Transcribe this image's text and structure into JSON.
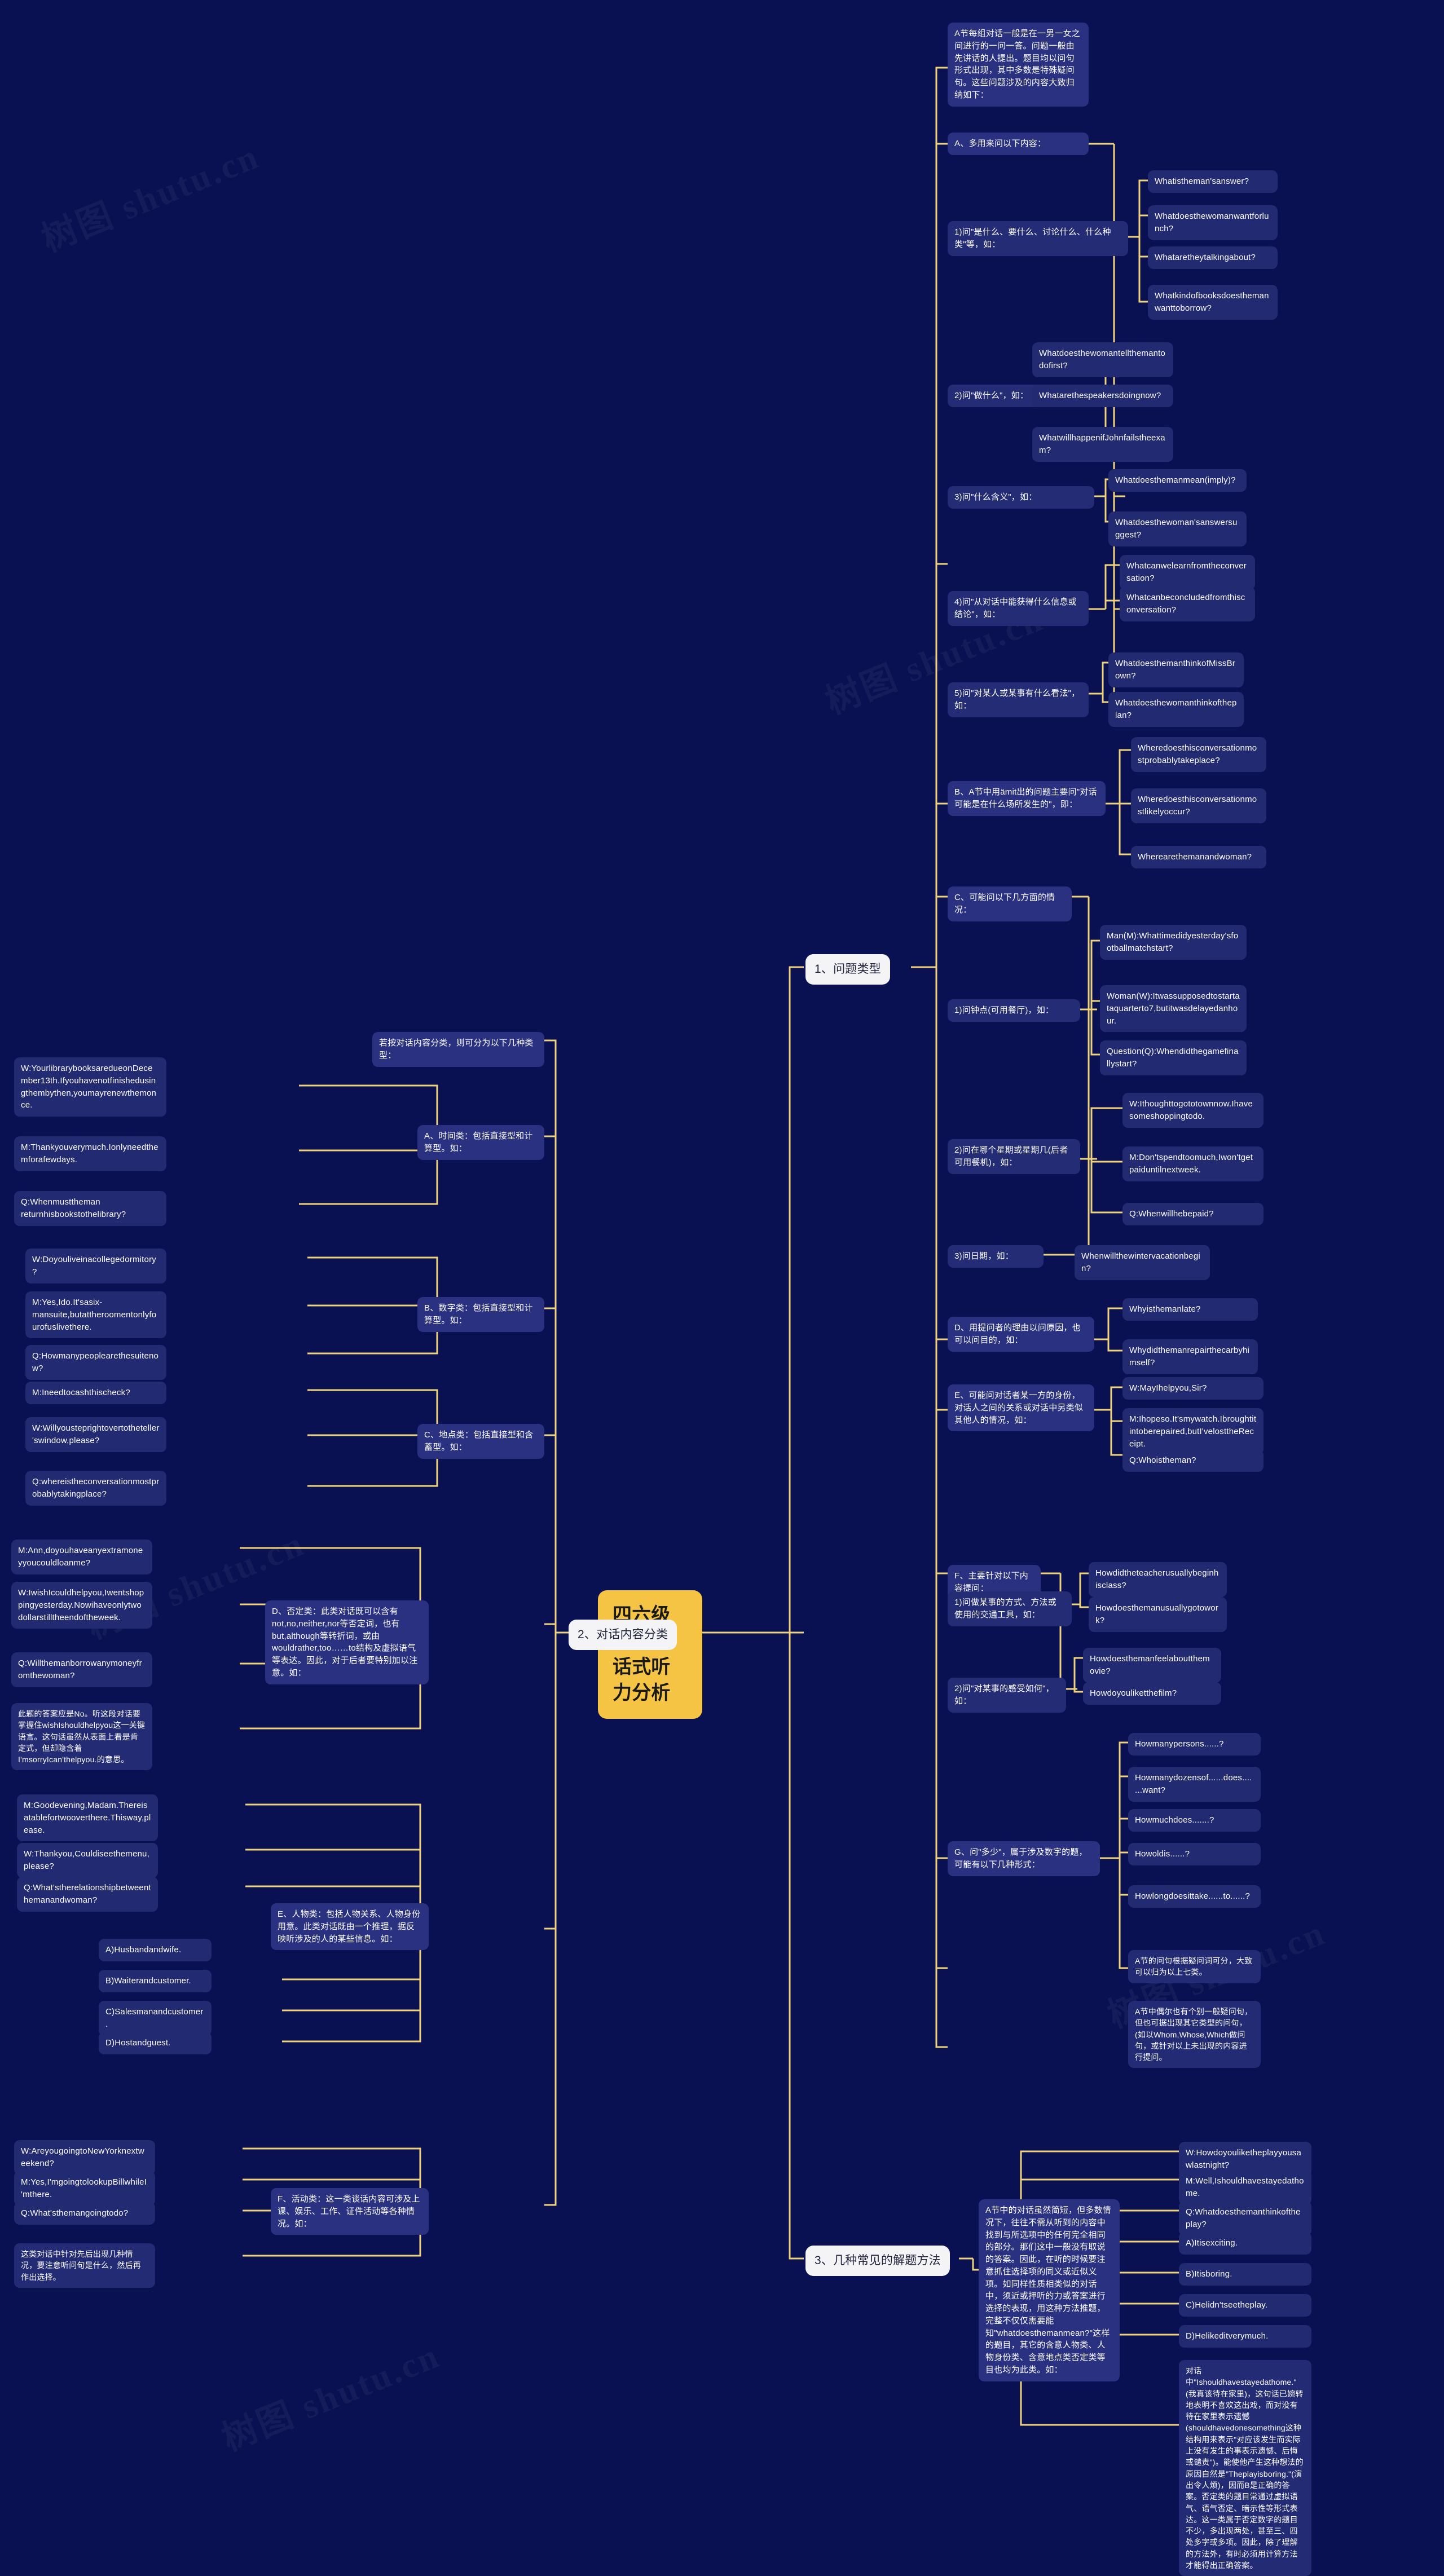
{
  "theme": {
    "background": "#0a1152",
    "root_fill": "#f5c444",
    "branch_pill_fill": "#f4f4f6",
    "node_fill": "#2a3180",
    "link_color": "#f0d27a",
    "text_light": "#ffffff",
    "text_dark": "#20243c"
  },
  "watermarks": [
    "树图 shutu.cn",
    "树图 shutu.cn",
    "树图 shutu.cn",
    "树图 shutu.cn",
    "树图 shutu.cn"
  ],
  "root": {
    "label": "四六级考试对话式听力分析"
  },
  "branches": [
    {
      "id": "b1",
      "label": "1、问题类型"
    },
    {
      "id": "b2",
      "label": "2、对话内容分类"
    },
    {
      "id": "b3",
      "label": "3、几种常见的解题方法"
    }
  ],
  "b1": {
    "intro": "A节每组对话一般是在一男一女之间进行的一问一答。问题一般由先讲话的人提出。题目均以问句形式出现，其中多数是特殊疑问句。这些问题涉及的内容大致归纳如下：",
    "groups": [
      {
        "label": "A、多用来问以下内容：",
        "items": [
          {
            "label": "1)问\"是什么、要什么、讨论什么、什么种类\"等，如：",
            "examples": [
              "Whatistheman'sanswer?",
              "Whatdoesthewomanwantforlunch?",
              "Whataretheytalkingabout?",
              "Whatkindofbooksdoesthemanwanttoborrow?"
            ]
          },
          {
            "label": "2)问\"做什么\"，如：",
            "examples": [
              "Whatdoesthewomantellthemantodofirst?",
              "Whatarethespeakersdoingnow?",
              "WhatwillhappenifJohnfailstheexam?"
            ]
          },
          {
            "label": "3)问\"什么含义\"，如：",
            "examples": [
              "Whatdoesthemanmean(imply)?",
              "Whatdoesthewoman'sanswersuggest?"
            ]
          },
          {
            "label": "4)问\"从对话中能获得什么信息或结论\"，如：",
            "examples": [
              "Whatcanwelearnfromtheconversation?",
              "Whatcanbeconcludedfromthisconversation?"
            ]
          },
          {
            "label": "5)问\"对某人或某事有什么看法\"，如：",
            "examples": [
              "WhatdoesthemanthinkofMissBrown?",
              "Whatdoesthewomanthinkoftheplan?"
            ]
          }
        ]
      },
      {
        "label": "B、A节中用ämit出的问题主要问\"对话可能是在什么场所发生的\"，即：",
        "examples": [
          "Wheredoesthisconversationmostprobablytakeplace?",
          "Wheredoesthisconversationmostlikelyoccur?",
          "Wherearethemanandwoman?"
        ]
      },
      {
        "label": "C、可能问以下几方面的情况：",
        "items": [
          {
            "label": "1)问钟点(可用餐厅)，如：",
            "examples": [
              "Man(M):Whattimedidyesterday'sfootballmatchstart?",
              "Woman(W):Itwassupposedtostartataquarterto7,butitwasdelayedanhour.",
              "Question(Q):Whendidthegamefinallystart?"
            ]
          },
          {
            "label": "2)问在哪个星期或星期几(后者可用餐机)，如：",
            "examples": [
              "W:Ithoughttogototownnow.Ihavesomeshoppingtodo.",
              "M:Don'tspendtoomuch,Iwon'tgetpaiduntilnextweek.",
              "Q:Whenwillhebepaid?"
            ]
          },
          {
            "label": "3)问日期，如：",
            "examples": [
              "Whenwillthewintervacationbegin?"
            ]
          }
        ]
      },
      {
        "label": "D、用提问者的理由以问原因，也可以问目的，如：",
        "examples": [
          "Whyisthemanlate?",
          "Whydidthemanrepairthecarbyhimself?"
        ]
      },
      {
        "label": "E、可能问对话者某一方的身份，对话人之间的关系或对话中另类似其他人的情况，如：",
        "examples": [
          "W:MayIhelpyou,Sir?",
          "M:Ihopeso.It'smywatch.Ibroughtitintoberepaired,butI'velosttheReceipt.",
          "Q:Whoistheman?"
        ]
      },
      {
        "label": "F、主要针对以下内容提问：",
        "items": [
          {
            "label": "1)问做某事的方式、方法或使用的交通工具，如：",
            "examples": [
              "Howdidtheteacherusuallybeginhisclass?",
              "Howdoesthemanusuallygotowork?"
            ]
          },
          {
            "label": "2)问\"对某事的感受如何\"，如：",
            "examples": [
              "Howdoesthemanfeelaboutthemovie?",
              "Howdoyouliketthefilm?"
            ]
          }
        ]
      },
      {
        "label": "G、问\"多少\"，属于涉及数字的题，可能有以下几种形式：",
        "examples": [
          "Howmanypersons......?",
          "Howmanydozensof......does.......want?",
          "Howmuchdoes.......?",
          "Howoldis......?",
          "Howlongdoesittake......to......?"
        ]
      }
    ],
    "tail_notes": [
      "A节的问句根据疑问词可分，大致可以归为以上七类。",
      "A节中偶尔也有个别一般疑问句，但也可据出现其它类型的问句，(如以Whom,Whose,Which做问句，或针对以上未出现的内容进行提问。"
    ]
  },
  "b2": {
    "intro": "若按对话内容分类，则可分为以下几种类型：",
    "groups": [
      {
        "label": "A、时间类：包括直接型和计算型。如：",
        "examples": [
          "W:YourlibrarybooksaredueonDecember13th.Ifyouhavenotfinishedusingthembythen,youmayrenewthemonce.",
          "M:Thankyouverymuch.Ionlyneedthemforafewdays.",
          "Q:Whenmusttheman returnhisbookstothelibrary?"
        ]
      },
      {
        "label": "B、数字类：包括直接型和计算型。如：",
        "examples": [
          "W:Doyouliveinacollegedormitory?",
          "M:Yes,Ido.It'sasix-mansuite,butattheroomentonlyfourofuslivethere.",
          "Q:Howmanypeoplearethesuitenow?"
        ]
      },
      {
        "label": "C、地点类：包括直接型和含蓄型。如：",
        "examples": [
          "M:Ineedtocashthischeck?",
          "W:Willyousteprightovertotheteller'swindow,please?",
          "Q:whereistheconversationmostprobablytakingplace?"
        ]
      },
      {
        "label": "D、否定类：此类对话既可以含有not,no,neither,nor等否定词，也有but,although等转折词，或由wouldrather,too……to结构及虚拟语气等表达。因此，对于后者要特别加以注意。如：",
        "examples": [
          "M:Ann,doyouhaveanyextramoneyyoucouldloanme?",
          "W:IwishIcouldhelpyou,Iwentshoppingyesterday.Nowihaveonlytwodollarstilltheendoftheweek.",
          "Q:Willthemanborrowanymoneyfromthewoman?"
        ],
        "note": "此题的答案应是No。听这段对话要掌握住wishIshouldhelpyou这一关键语言。这句话虽然从表面上看是肯定式，但却隐含着I'msorryIcan'thelpyou.的意思。"
      },
      {
        "label": "E、人物类：包括人物关系、人物身份用意。此类对话既由一个推理，据反映听涉及的人的某些信息。如：",
        "examples": [
          "M:Goodevening,Madam.Thereisatablefortwooverthere.Thisway,please.",
          "W:Thankyou,Couldiseethemenu,please?",
          "Q:What'stherelationshipbetweenthemanandwoman?"
        ],
        "options": [
          "A)Husbandandwife.",
          "B)Waiterandcustomer.",
          "C)Salesmanandcustomer.",
          "D)Hostandguest."
        ]
      },
      {
        "label": "F、活动类：这一类谈话内容可涉及上课、娱乐、工作、证件活动等各种情况。如：",
        "examples": [
          "W:AreyougoingtoNewYorknextweekend?",
          "M:Yes,I'mgoingtolookupBillwhileI'mthere.",
          "Q:What'sthemangoingtodo?"
        ],
        "note": "这类对话中针对先后出现几种情况，要注意听问句是什么，然后再作出选择。"
      }
    ]
  },
  "b3": {
    "intro": "A节中的对话虽然简短，但多数情况下，往往不需从听到的内容中找到与所选项中的任何完全相同的部分。那们这中一般没有取说的答案。因此，在听的时候要注意抓住选择项的同义或近似义项。如同样性质相类似的对话中，须近或押听的力或答案进行选择的表现，用这种方法推题，完整不仅仅需要能知\"whatdoesthemanmean?\"这样的题目，其它的含意人物类、人物身份类、含意地点类否定类等目也均为此类。如：",
    "examples": [
      "W:Howdoyouliketheplayyousawlastnight?",
      "M:Well,Ishouldhavestayedathome.",
      "Q:Whatdoesthemanthinkoftheplay?",
      "A)Itisexciting.",
      "B)Itisboring.",
      "C)Helidn'tseetheplay.",
      "D)Helikeditverymuch."
    ],
    "note": "对话中\"Ishouldhavestayedathome.\"(我真该待在家里)，这句话已婉转地表明不喜欢这出戏，而对没有待在家里表示遗憾(shouldhavedonesomething这种结构用来表示\"对应该发生而实际上没有发生的事表示遗憾、后悔或谴责\")。能使他产生这种想法的原因自然是\"Theplayisboring.\"(演出令人烦)，因而B是正确的答案。否定类的题目常通过虚拟语气、语气否定、暗示性等形式表达。这一类属于否定数字的题目不少，多出现两处，甚至三、四处多字或多项。因此，除了理解的方法外，有时必须用计算方法才能得出正确答案。"
  }
}
